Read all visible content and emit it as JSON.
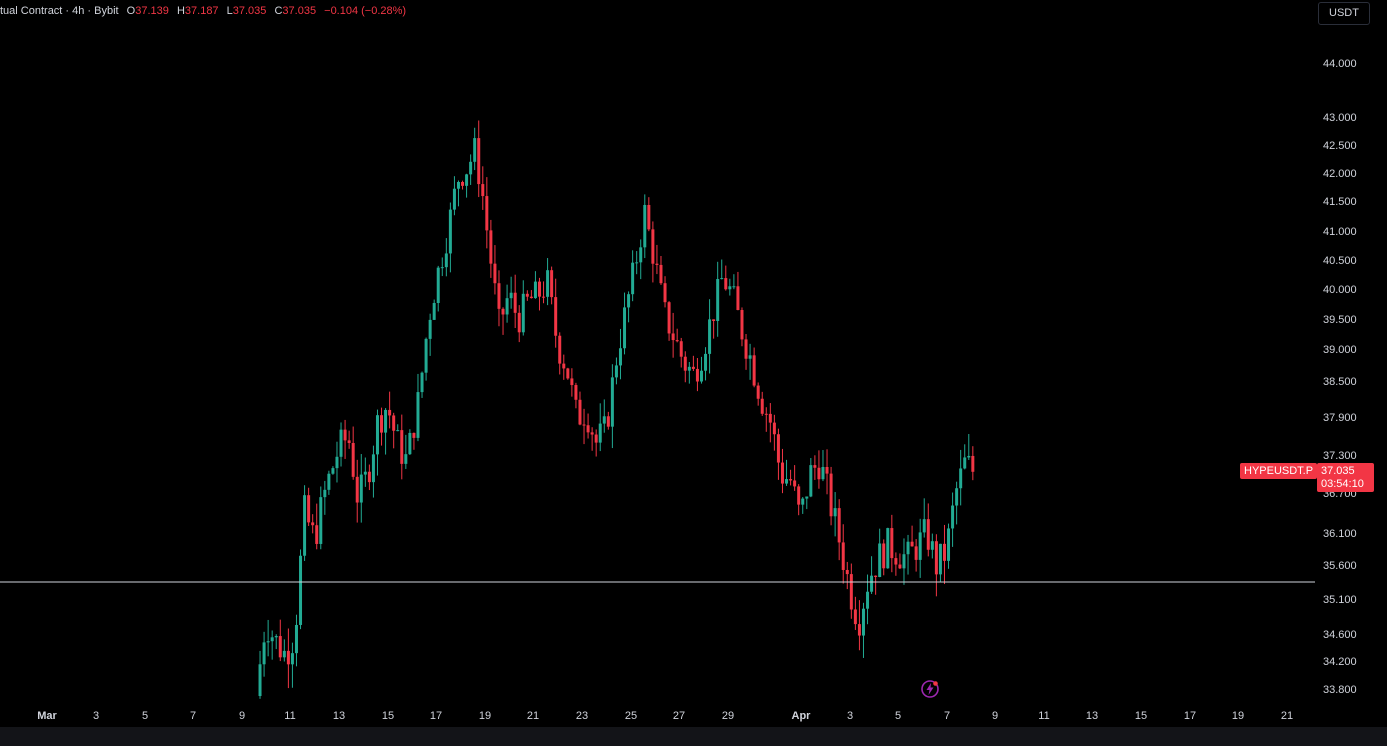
{
  "header": {
    "symbol": "tual Contract · 4h · Bybit",
    "o_label": "O",
    "o_value": "37.139",
    "h_label": "H",
    "h_value": "37.187",
    "l_label": "L",
    "l_value": "37.035",
    "c_label": "C",
    "c_value": "37.035",
    "change": "−0.104 (−0.28%)"
  },
  "price_axis_unit": "USDT",
  "price_tag": {
    "symbol": "HYPEUSDT.P",
    "price": "37.035",
    "countdown": "03:54:10"
  },
  "colors": {
    "up": "#22ab94",
    "down": "#f23645",
    "background": "#000000",
    "hline": "#d1d4dc",
    "text": "#d1d4dc"
  },
  "icons": {
    "alert": "lightning-bolt-icon"
  },
  "chart_data": {
    "type": "candlestick",
    "interval": "4h",
    "y_ticks": [
      "44.000",
      "43.000",
      "42.500",
      "42.000",
      "41.500",
      "41.000",
      "40.500",
      "40.000",
      "39.500",
      "39.000",
      "38.500",
      "37.900",
      "37.300",
      "36.700",
      "36.100",
      "35.600",
      "35.100",
      "34.600",
      "34.200",
      "33.800"
    ],
    "x_ticks": [
      "Mar",
      "3",
      "5",
      "7",
      "9",
      "11",
      "13",
      "15",
      "17",
      "19",
      "21",
      "23",
      "25",
      "27",
      "29",
      "Apr",
      "3",
      "5",
      "7",
      "9",
      "11",
      "13",
      "15",
      "17",
      "19",
      "21"
    ],
    "horizontal_line": 35.35,
    "last_price": 37.035,
    "close_path": [
      [
        9.6,
        33.7
      ],
      [
        10.0,
        34.8
      ],
      [
        10.4,
        34.5
      ],
      [
        10.8,
        34.3
      ],
      [
        11.2,
        34.6
      ],
      [
        11.6,
        36.4
      ],
      [
        12.0,
        36.0
      ],
      [
        12.5,
        36.8
      ],
      [
        13.0,
        37.4
      ],
      [
        13.4,
        37.6
      ],
      [
        13.8,
        36.6
      ],
      [
        14.2,
        37.0
      ],
      [
        14.6,
        37.8
      ],
      [
        15.0,
        38.1
      ],
      [
        15.4,
        37.5
      ],
      [
        15.8,
        37.2
      ],
      [
        16.3,
        38.2
      ],
      [
        16.7,
        39.5
      ],
      [
        17.1,
        40.3
      ],
      [
        17.5,
        41.0
      ],
      [
        17.9,
        41.9
      ],
      [
        18.3,
        42.1
      ],
      [
        18.6,
        42.4
      ],
      [
        18.9,
        41.7
      ],
      [
        19.2,
        40.7
      ],
      [
        19.6,
        39.4
      ],
      [
        20.0,
        39.9
      ],
      [
        20.4,
        39.5
      ],
      [
        20.8,
        39.8
      ],
      [
        21.2,
        39.9
      ],
      [
        21.6,
        40.1
      ],
      [
        22.0,
        39.1
      ],
      [
        22.4,
        38.7
      ],
      [
        22.8,
        37.9
      ],
      [
        23.2,
        38.0
      ],
      [
        23.6,
        37.5
      ],
      [
        24.0,
        37.7
      ],
      [
        24.4,
        38.8
      ],
      [
        24.8,
        39.6
      ],
      [
        25.2,
        40.4
      ],
      [
        25.6,
        41.3
      ],
      [
        26.0,
        40.5
      ],
      [
        26.4,
        39.6
      ],
      [
        26.8,
        39.2
      ],
      [
        27.2,
        38.8
      ],
      [
        27.6,
        38.6
      ],
      [
        28.0,
        39.0
      ],
      [
        28.4,
        39.6
      ],
      [
        28.8,
        40.2
      ],
      [
        29.2,
        39.9
      ],
      [
        29.6,
        39.3
      ],
      [
        30.0,
        38.8
      ],
      [
        30.4,
        38.2
      ],
      [
        30.8,
        37.8
      ],
      [
        31.2,
        37.0
      ],
      [
        31.6,
        36.9
      ],
      [
        32.0,
        36.3
      ],
      [
        32.4,
        37.0
      ],
      [
        32.8,
        37.2
      ],
      [
        33.2,
        36.6
      ],
      [
        33.6,
        36.0
      ],
      [
        34.0,
        35.3
      ],
      [
        34.4,
        34.8
      ],
      [
        34.8,
        35.4
      ],
      [
        35.2,
        35.7
      ],
      [
        35.6,
        35.9
      ],
      [
        36.0,
        35.8
      ],
      [
        36.4,
        35.7
      ],
      [
        36.8,
        35.9
      ],
      [
        37.2,
        36.1
      ],
      [
        37.6,
        35.6
      ],
      [
        38.0,
        35.8
      ],
      [
        38.4,
        36.7
      ],
      [
        38.8,
        37.2
      ],
      [
        39.1,
        37.035
      ]
    ]
  }
}
